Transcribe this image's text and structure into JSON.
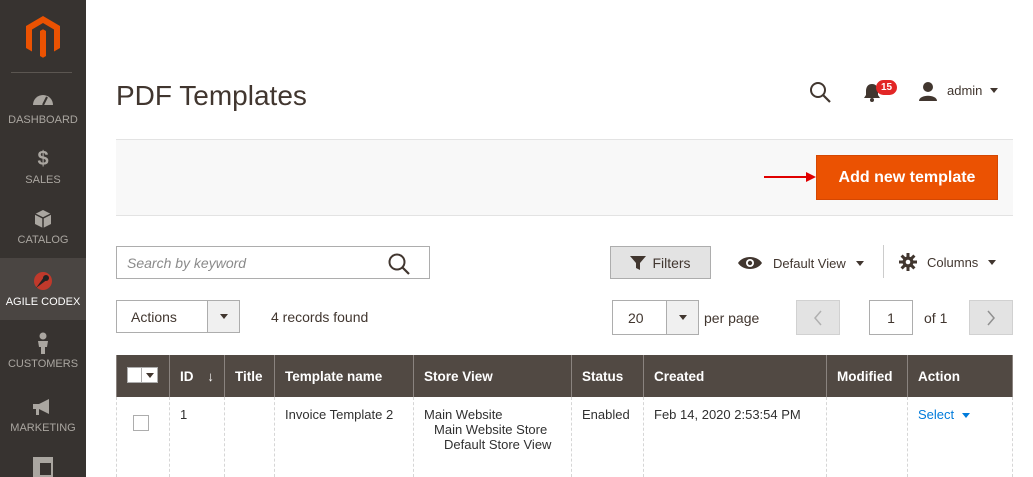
{
  "sidebar": {
    "logo": "magento-logo",
    "items": [
      {
        "label": "DASHBOARD",
        "icon": "speedometer-icon"
      },
      {
        "label": "SALES",
        "icon": "dollar-icon"
      },
      {
        "label": "CATALOG",
        "icon": "box-icon"
      },
      {
        "label": "AGILE CODEX",
        "icon": "agile-codex-icon",
        "active": true
      },
      {
        "label": "CUSTOMERS",
        "icon": "person-icon"
      },
      {
        "label": "MARKETING",
        "icon": "megaphone-icon"
      },
      {
        "label": "",
        "icon": "layout-icon"
      }
    ]
  },
  "header": {
    "title": "PDF Templates",
    "notifications_count": "15",
    "user": "admin"
  },
  "action_bar": {
    "add_button": "Add new template"
  },
  "toolbar": {
    "search_placeholder": "Search by keyword",
    "filters": "Filters",
    "view": "Default View",
    "columns": "Columns",
    "actions": "Actions",
    "records": "4 records found",
    "per_page_value": "20",
    "per_page_label": "per page",
    "page": "1",
    "of_pages": "of 1"
  },
  "grid": {
    "headers": [
      "ID",
      "Title",
      "Template name",
      "Store View",
      "Status",
      "Created",
      "Modified",
      "Action"
    ],
    "rows": [
      {
        "id": "1",
        "title": "",
        "template_name": "Invoice Template 2",
        "store_view": [
          "Main Website",
          "Main Website Store",
          "Default Store View"
        ],
        "status": "Enabled",
        "created": "Feb 14, 2020 2:53:54 PM",
        "modified": "",
        "action": "Select"
      }
    ]
  },
  "colors": {
    "sidebar_bg": "#373330",
    "accent": "#eb5202",
    "grid_header": "#514943",
    "link": "#007bdb",
    "badge": "#e22626"
  }
}
